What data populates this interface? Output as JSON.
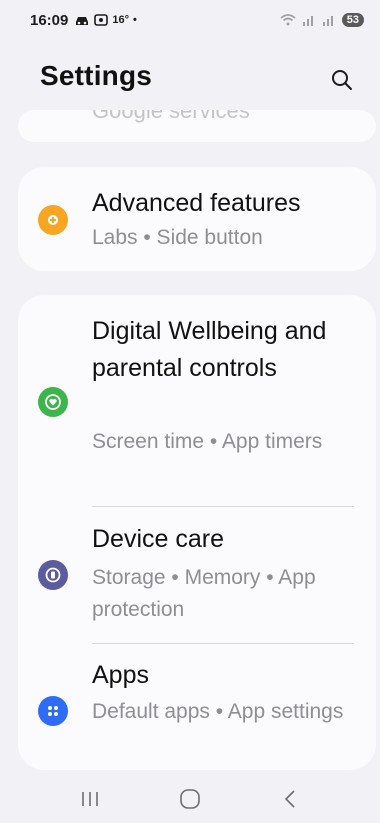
{
  "status_bar": {
    "time": "16:09",
    "temperature": "16°",
    "dot": "•",
    "battery_level": "53"
  },
  "header": {
    "title": "Settings",
    "search_icon": "search-icon"
  },
  "partial_item": {
    "label": "Google services"
  },
  "advanced": {
    "title": "Advanced features",
    "subtitle": "Labs  •  Side button",
    "icon": "gear-plus-icon",
    "icon_color": "#f6a623"
  },
  "wellbeing": {
    "title": "Digital Wellbeing and parental controls",
    "subtitle": "Screen time  •  App timers",
    "icon": "heart-circle-icon",
    "icon_color": "#3cb54a"
  },
  "device_care": {
    "title": "Device care",
    "subtitle": "Storage  •  Memory  •  App protection",
    "icon": "device-care-icon",
    "icon_color": "#5b5b9e"
  },
  "apps": {
    "title": "Apps",
    "subtitle": "Default apps  •  App settings",
    "icon": "apps-grid-icon",
    "icon_color": "#2f6cf6"
  },
  "nav": {
    "recents": "recents-icon",
    "home": "home-icon",
    "back": "back-icon"
  }
}
